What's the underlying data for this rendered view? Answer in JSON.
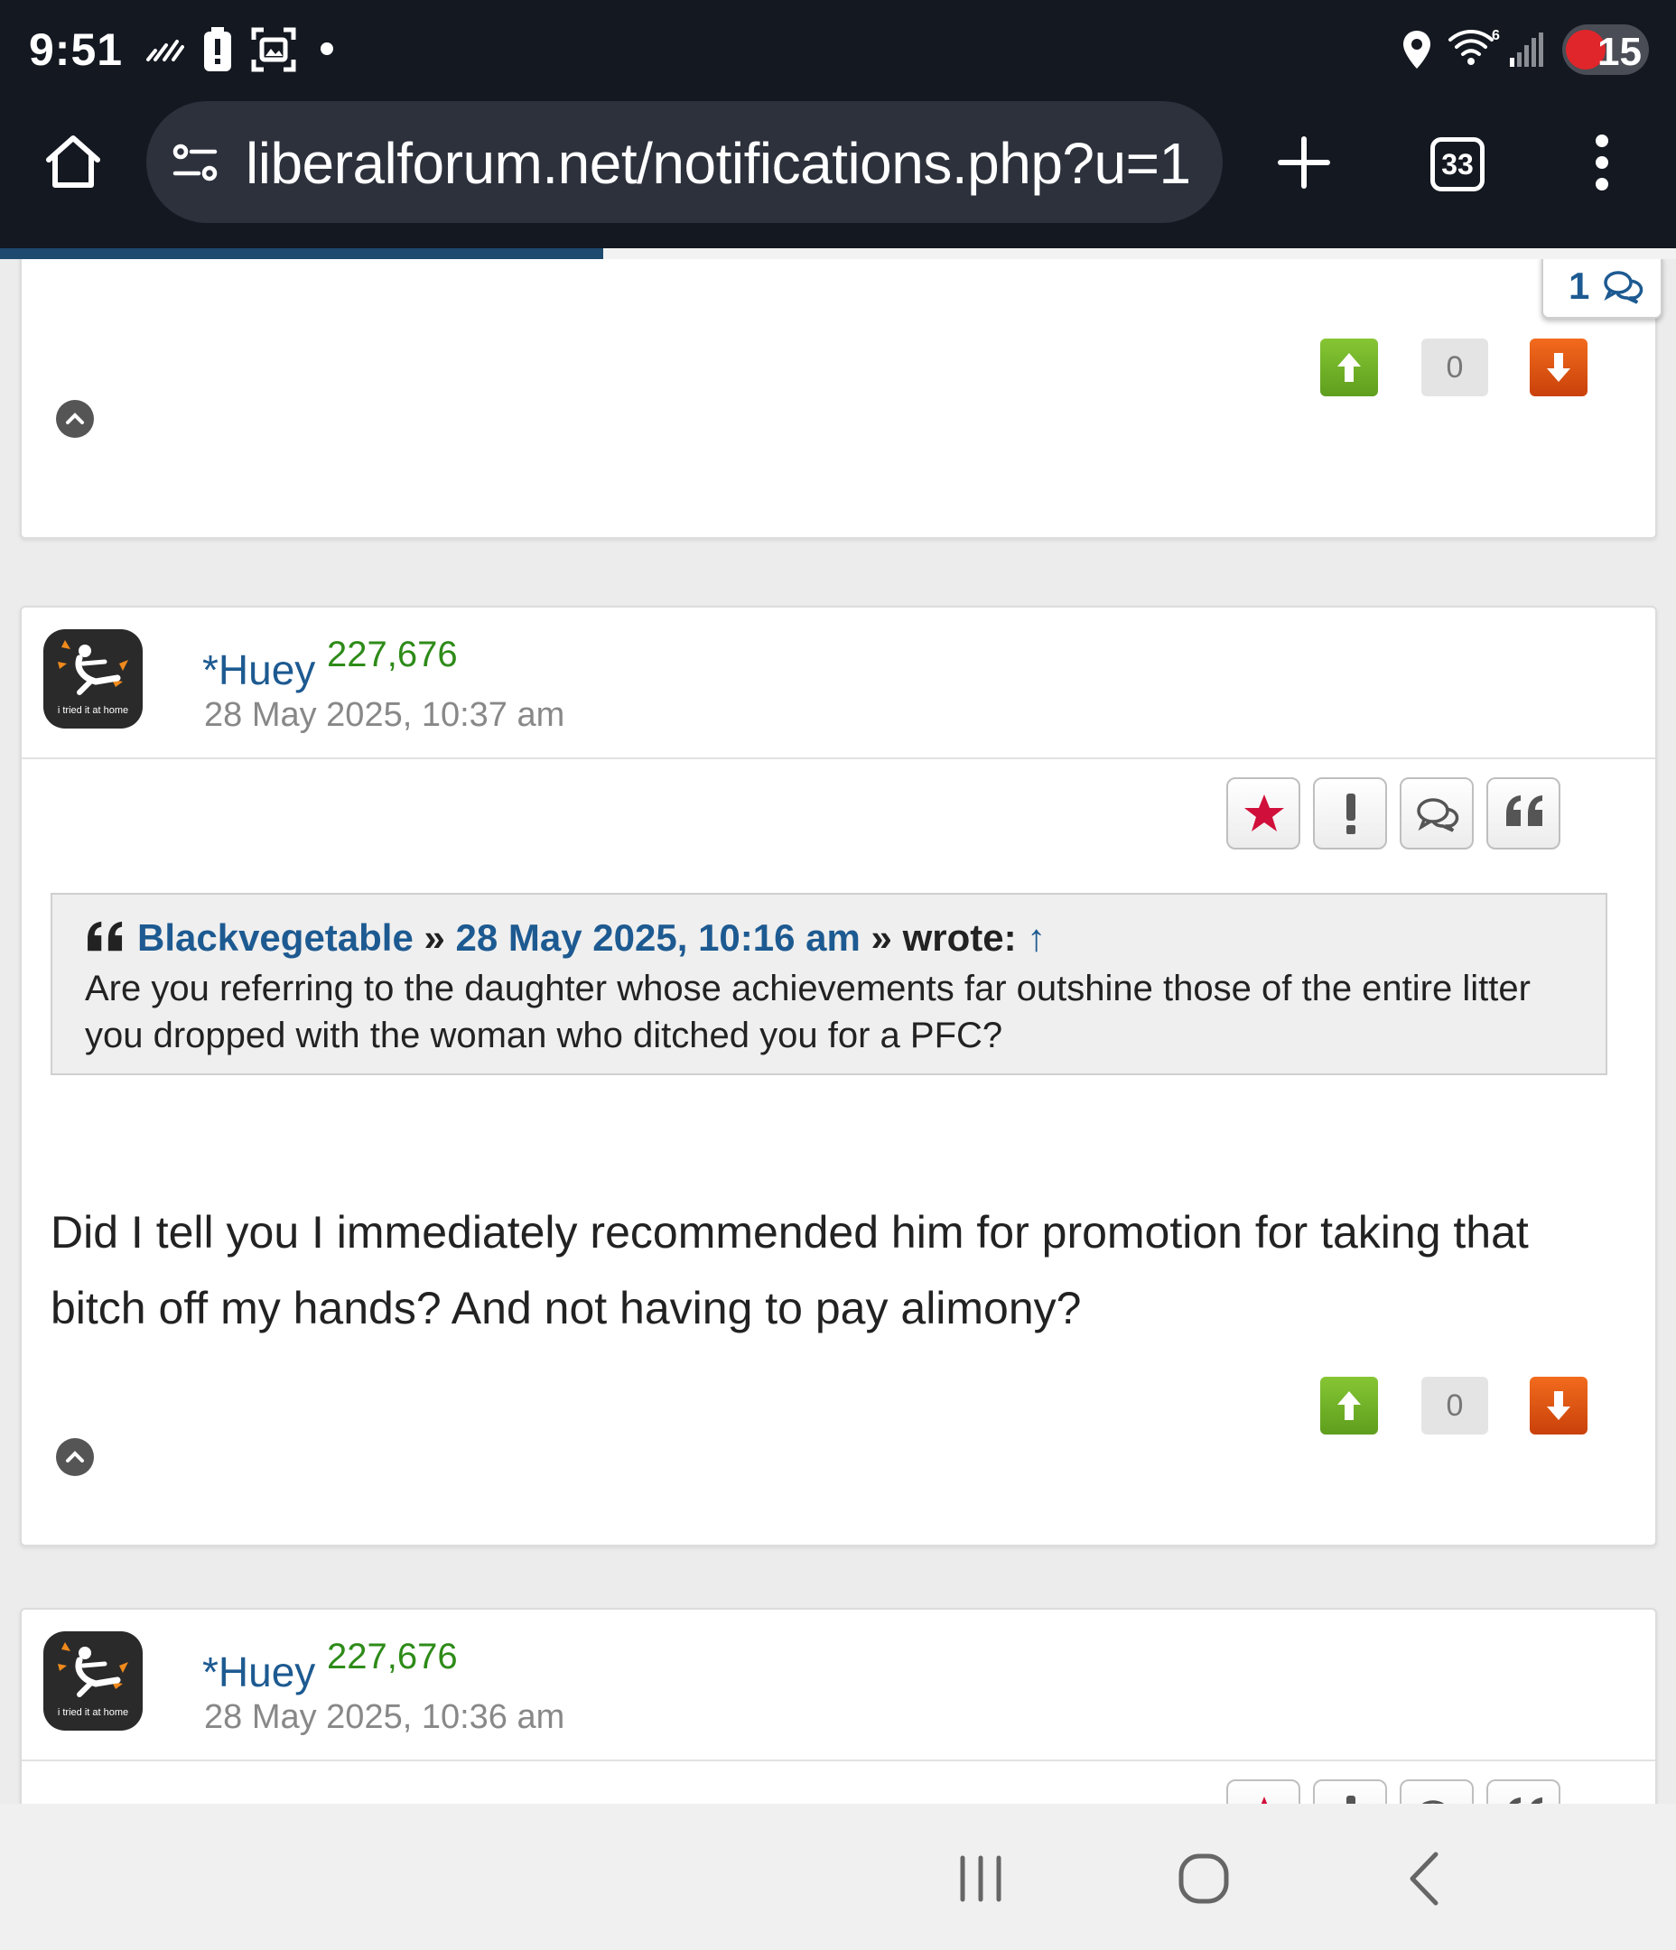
{
  "status_bar": {
    "time": "9:51",
    "battery_level": "15",
    "icons": [
      "no-signal-icon",
      "battery-alert-icon",
      "screenshot-icon",
      "dot-icon",
      "location-icon",
      "wifi-6-icon",
      "cell-signal-icon",
      "battery-saver-icon"
    ]
  },
  "browser": {
    "url": "liberalforum.net/notifications.php?u=1",
    "tab_count": "33",
    "icons": [
      "home-icon",
      "site-settings-icon",
      "new-tab-icon",
      "tabs-icon",
      "more-menu-icon"
    ],
    "load_progress": 0.36
  },
  "posts": [
    {
      "comment_count": "1",
      "vote_count": "0"
    },
    {
      "username": "*Huey",
      "points": "227,676",
      "timestamp": "28 May 2025, 10:37 am",
      "avatar_caption": "i tried it at home",
      "quote": {
        "author": "Blackvegetable",
        "sep1": "»",
        "date": "28 May 2025, 10:16 am",
        "sep2": "»",
        "wrote": "wrote:",
        "arrow": "↑",
        "text": "Are you referring to the daughter whose achievements far outshine those of the entire litter you dropped with the woman who ditched you for a PFC?"
      },
      "body": "Did I tell you I immediately recommended him for promotion for taking that bitch off my hands?  And not having to pay alimony?",
      "vote_count": "0",
      "actions": [
        "favorite-icon",
        "report-icon",
        "reply-icon",
        "quote-icon"
      ]
    },
    {
      "username": "*Huey",
      "points": "227,676",
      "timestamp": "28 May 2025, 10:36 am",
      "avatar_caption": "i tried it at home"
    }
  ],
  "colors": {
    "link_blue": "#1d5a91",
    "points_green": "#2e8b19",
    "upvote_green": "#6fb025",
    "downvote_orange": "#e2561a",
    "favorite_red": "#d0103a",
    "chrome_dark": "#141821"
  },
  "nav": {
    "icons": [
      "recents-icon",
      "home-nav-icon",
      "back-icon"
    ]
  }
}
